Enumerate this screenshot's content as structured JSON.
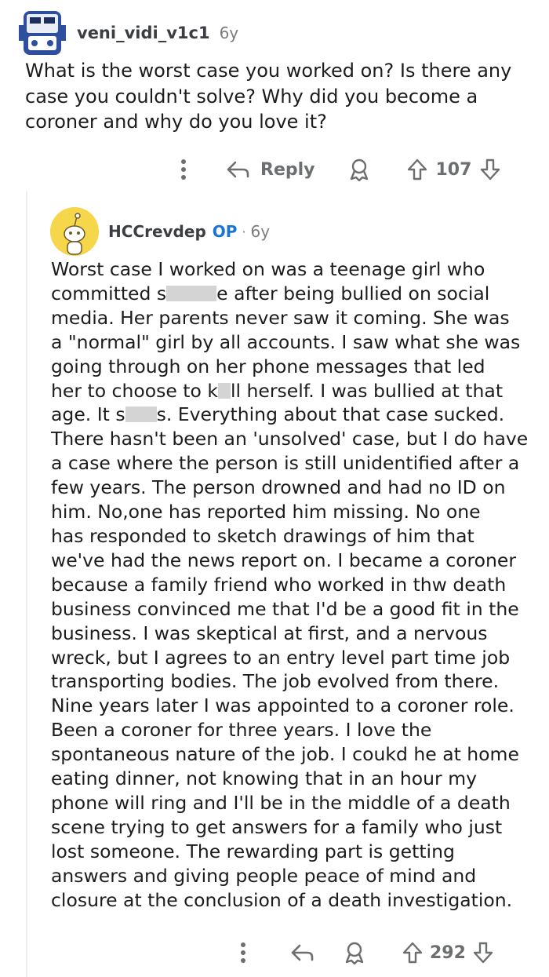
{
  "comment1": {
    "username": "veni_vidi_v1c1",
    "age": "6y",
    "text": "What is the worst case you worked on? Is there any case you couldn't solve? Why did you become a coroner and why do you love it?",
    "lines": [
      "What is the worst case you worked on? Is there any",
      "case you couldn't solve? Why did you become a",
      "coroner and why do you love it?"
    ],
    "actions": {
      "reply_label": "Reply",
      "votes": "107"
    }
  },
  "comment2": {
    "username": "HCCrevdep",
    "op_badge": "OP",
    "age": "6y",
    "lines": [
      "Worst case I worked on was a teenage girl who",
      [
        "committed s",
        "e after being bullied on social"
      ],
      "media. Her parents never saw it coming. She was",
      "a \"normal\" girl by all accounts. I saw what she was",
      "going through on her phone messages that led",
      [
        "her to choose to k",
        "ll herself. I was bullied at that"
      ],
      [
        "age. It s",
        "s. Everything about that case sucked."
      ],
      "There hasn't been an 'unsolved' case, but I do have",
      "a case where the person is still unidentified after a",
      "few years. The person drowned and had no ID on",
      "him. No,one has reported him missing. No one",
      "has responded to sketch drawings of him that",
      "we've had the news report on. I became a coroner",
      "because a family friend who worked in thw death",
      "business convinced me that I'd be a good fit in the",
      "business. I was skeptical at first, and a nervous",
      "wreck, but I agrees to an entry level part time job",
      "transporting bodies. The job evolved from there.",
      "Nine years later I was appointed to a coroner role.",
      "Been a coroner for three years. I love the",
      "spontaneous nature of the job. I coukd he at home",
      "eating dinner, not knowing that in an hour my",
      "phone will ring and I'll be in the middle of a death",
      "scene trying to get answers for a family who just",
      "lost someone. The rewarding part is getting",
      "answers and giving people peace of mind and",
      "closure at the conclusion of a death investigation."
    ],
    "actions": {
      "votes": "292"
    }
  },
  "icons": [
    "more-vertical-icon",
    "reply-arrow-icon",
    "award-icon",
    "upvote-icon",
    "downvote-icon"
  ],
  "colors": {
    "op_blue": "#1a73d6",
    "text": "#1c1c1c",
    "meta": "#7c7c7c",
    "avatar_yellow": "#f6d64a"
  }
}
